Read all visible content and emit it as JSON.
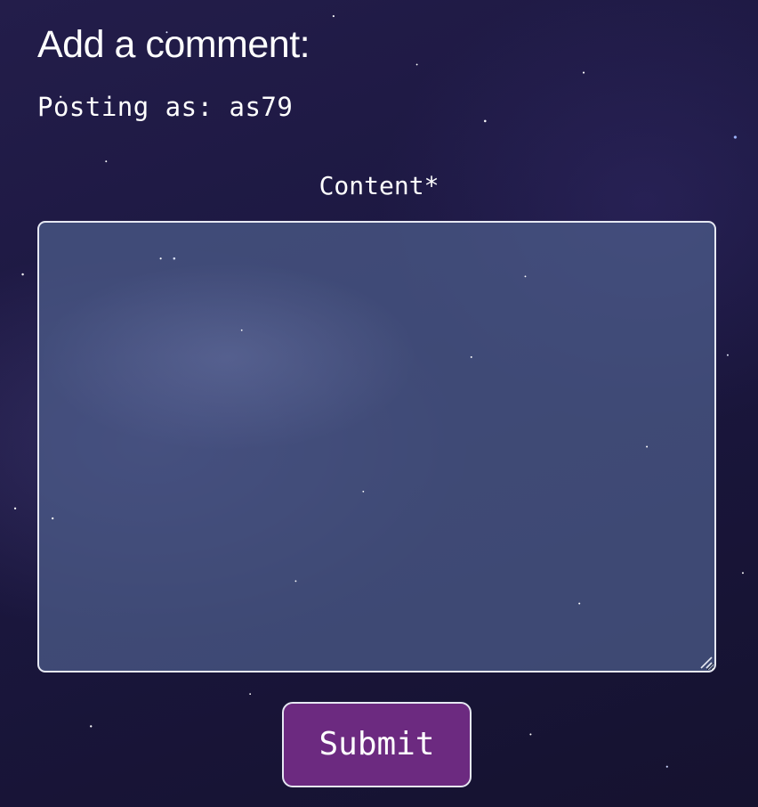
{
  "form": {
    "title": "Add a comment:",
    "posting_as": "Posting as: as79",
    "content_label": "Content*",
    "content_value": "",
    "submit_label": "Submit"
  },
  "colors": {
    "background": "#1a1638",
    "textarea_fill": "#4e5e8c",
    "border": "#e6e8f2",
    "submit_button": "#6c2a80",
    "text": "#ffffff"
  },
  "icons": {
    "resize_handle": "resize-handle-icon"
  }
}
